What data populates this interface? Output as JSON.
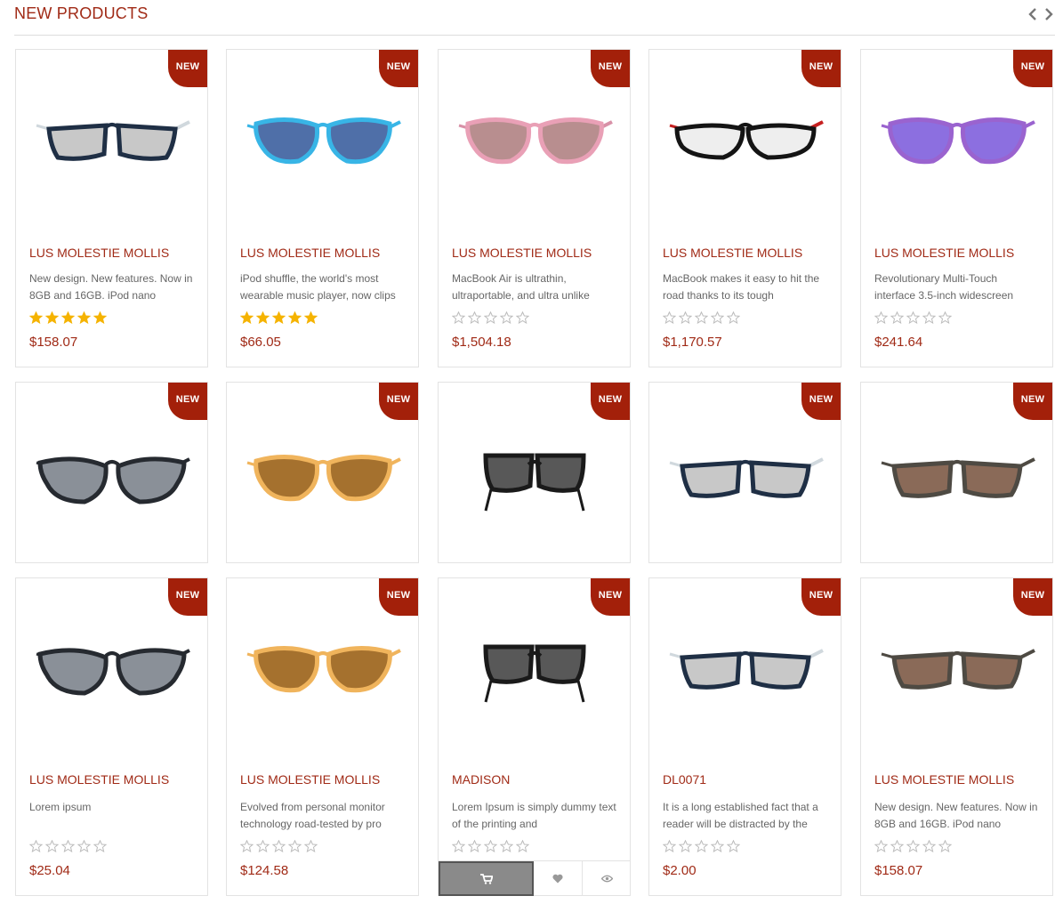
{
  "section": {
    "title": "NEW PRODUCTS",
    "prev_icon": "chevron-left-icon",
    "next_icon": "chevron-right-icon"
  },
  "badge_label": "NEW",
  "colors": {
    "accent": "#a02a16",
    "badge": "#a3200a",
    "star_filled": "#f5b301",
    "star_empty": "#bbbbbb"
  },
  "rows": [
    {
      "products": [
        {
          "name": "LUS MOLESTIE MOLLIS",
          "description": "New design. New features. Now in 8GB and 16GB. iPod nano",
          "rating": 5,
          "price": "$158.07",
          "image": "navy-clear-square-sunglasses"
        },
        {
          "name": "LUS MOLESTIE MOLLIS",
          "description": "iPod shuffle, the world's most wearable music player, now clips",
          "rating": 5,
          "price": "$66.05",
          "image": "blue-cat-eye-sunglasses"
        },
        {
          "name": "LUS MOLESTIE MOLLIS",
          "description": "MacBook Air is ultrathin, ultraportable, and ultra unlike",
          "rating": 0,
          "price": "$1,504.18",
          "image": "pink-cat-eye-sunglasses"
        },
        {
          "name": "LUS MOLESTIE MOLLIS",
          "description": "MacBook makes it easy to hit the road thanks to its tough",
          "rating": 0,
          "price": "$1,170.57",
          "image": "black-sport-glasses"
        },
        {
          "name": "LUS MOLESTIE MOLLIS",
          "description": "Revolutionary Multi-Touch interface 3.5-inch widescreen",
          "rating": 0,
          "price": "$241.64",
          "image": "purple-cat-eye-sunglasses"
        }
      ]
    },
    {
      "products": [
        {
          "image": "black-butterfly-sunglasses"
        },
        {
          "image": "amber-cat-eye-sunglasses"
        },
        {
          "image": "black-square-sunglasses"
        },
        {
          "image": "navy-clear-square-sunglasses"
        },
        {
          "image": "brown-gradient-square-sunglasses"
        }
      ]
    },
    {
      "products": [
        {
          "name": "LUS MOLESTIE MOLLIS",
          "description": "Lorem ipsum",
          "rating": 0,
          "price": "$25.04",
          "image": "black-butterfly-sunglasses"
        },
        {
          "name": "LUS MOLESTIE MOLLIS",
          "description": "Evolved from personal monitor technology road-tested by pro",
          "rating": 0,
          "price": "$124.58",
          "image": "amber-cat-eye-sunglasses"
        },
        {
          "name": "MADISON",
          "description": "Lorem Ipsum is simply dummy text of the printing and",
          "rating": 0,
          "price": "",
          "image": "black-square-sunglasses"
        },
        {
          "name": "DL0071",
          "description": "It is a long established fact that a reader will be distracted by the",
          "rating": 0,
          "price": "$2.00",
          "image": "navy-clear-square-sunglasses"
        },
        {
          "name": "LUS MOLESTIE MOLLIS",
          "description": "New design. New features. Now in 8GB and 16GB. iPod nano",
          "rating": 0,
          "price": "$158.07",
          "image": "brown-gradient-square-sunglasses"
        }
      ]
    }
  ],
  "hover_actions": {
    "cart_icon": "cart-icon",
    "wishlist_icon": "heart-icon",
    "quickview_icon": "eye-icon"
  }
}
